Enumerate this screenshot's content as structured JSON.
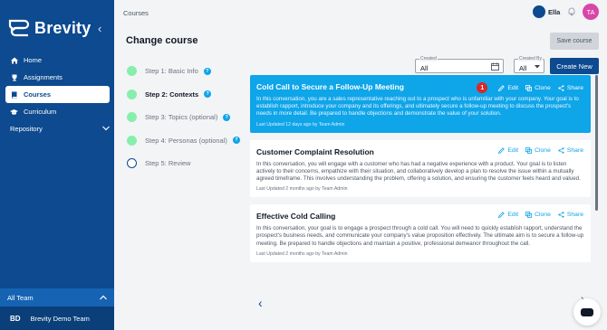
{
  "brand": {
    "name": "Brevity"
  },
  "nav": {
    "items": [
      {
        "label": "Home",
        "icon": "home-icon",
        "active": false
      },
      {
        "label": "Assignments",
        "icon": "trophy-icon",
        "active": false
      },
      {
        "label": "Courses",
        "icon": "book-icon",
        "active": true
      },
      {
        "label": "Curriculum",
        "icon": "graduation-cap-icon",
        "active": false
      }
    ],
    "repository": "Repository"
  },
  "team": {
    "label": "All Team",
    "initials": "BD",
    "name": "Brevity Demo Team"
  },
  "header": {
    "breadcrumb": "Courses",
    "user": "Ella",
    "avatar": "TA"
  },
  "page": {
    "title": "Change course",
    "save_label": "Save course",
    "create_label": "Create New"
  },
  "steps": [
    {
      "label": "Step 1: Basic Info",
      "done": true,
      "current": false,
      "help": true
    },
    {
      "label": "Step 2: Contexts",
      "done": true,
      "current": true,
      "help": true
    },
    {
      "label": "Step 3: Topics (optional)",
      "done": true,
      "current": false,
      "help": true
    },
    {
      "label": "Step 4: Personas (optional)",
      "done": true,
      "current": false,
      "help": true
    },
    {
      "label": "Step 5: Review",
      "done": false,
      "current": false,
      "help": false
    }
  ],
  "filters": {
    "created": {
      "label": "Created",
      "value": "All"
    },
    "created_by": {
      "label": "Created By",
      "value": "All"
    }
  },
  "actions": {
    "edit": "Edit",
    "clone": "Clone",
    "share": "Share"
  },
  "cards": [
    {
      "title": "Cold Call to Secure a Follow-Up Meeting",
      "description": "In this conversation, you are a sales representative reaching out to a prospect who is unfamiliar with your company. Your goal is to establish rapport, introduce your company and its offerings, and ultimately secure a follow-up meeting to discuss the prospect's needs in more detail. Be prepared to handle objections and demonstrate the value of your solution.",
      "updated": "Last Updated 12 days ago by Team Admin",
      "badge": "1",
      "selected": true
    },
    {
      "title": "Customer Complaint Resolution",
      "description": "In this conversation, you will engage with a customer who has had a negative experience with a product. Your goal is to listen actively to their concerns, empathize with their situation, and collaboratively develop a plan to resolve the issue within a mutually agreed timeframe. This involves understanding the problem, offering a solution, and ensuring the customer feels heard and valued.",
      "updated": "Last Updated 2 months ago by Team Admin",
      "selected": false
    },
    {
      "title": "Effective Cold Calling",
      "description": "In this conversation, your goal is to engage a prospect through a cold call. You will need to quickly establish rapport, understand the prospect's business needs, and communicate your company's value proposition effectively. The ultimate aim is to secure a follow-up meeting. Be prepared to handle objections and maintain a positive, professional demeanor throughout the call.",
      "updated": "Last Updated 2 months ago by Team Admin",
      "selected": false
    }
  ],
  "colors": {
    "sidebar": "#0d4a8f",
    "accent": "#0ea5e9",
    "avatar": "#d946a8",
    "badge": "#dc2626",
    "done_step": "#86efac"
  }
}
